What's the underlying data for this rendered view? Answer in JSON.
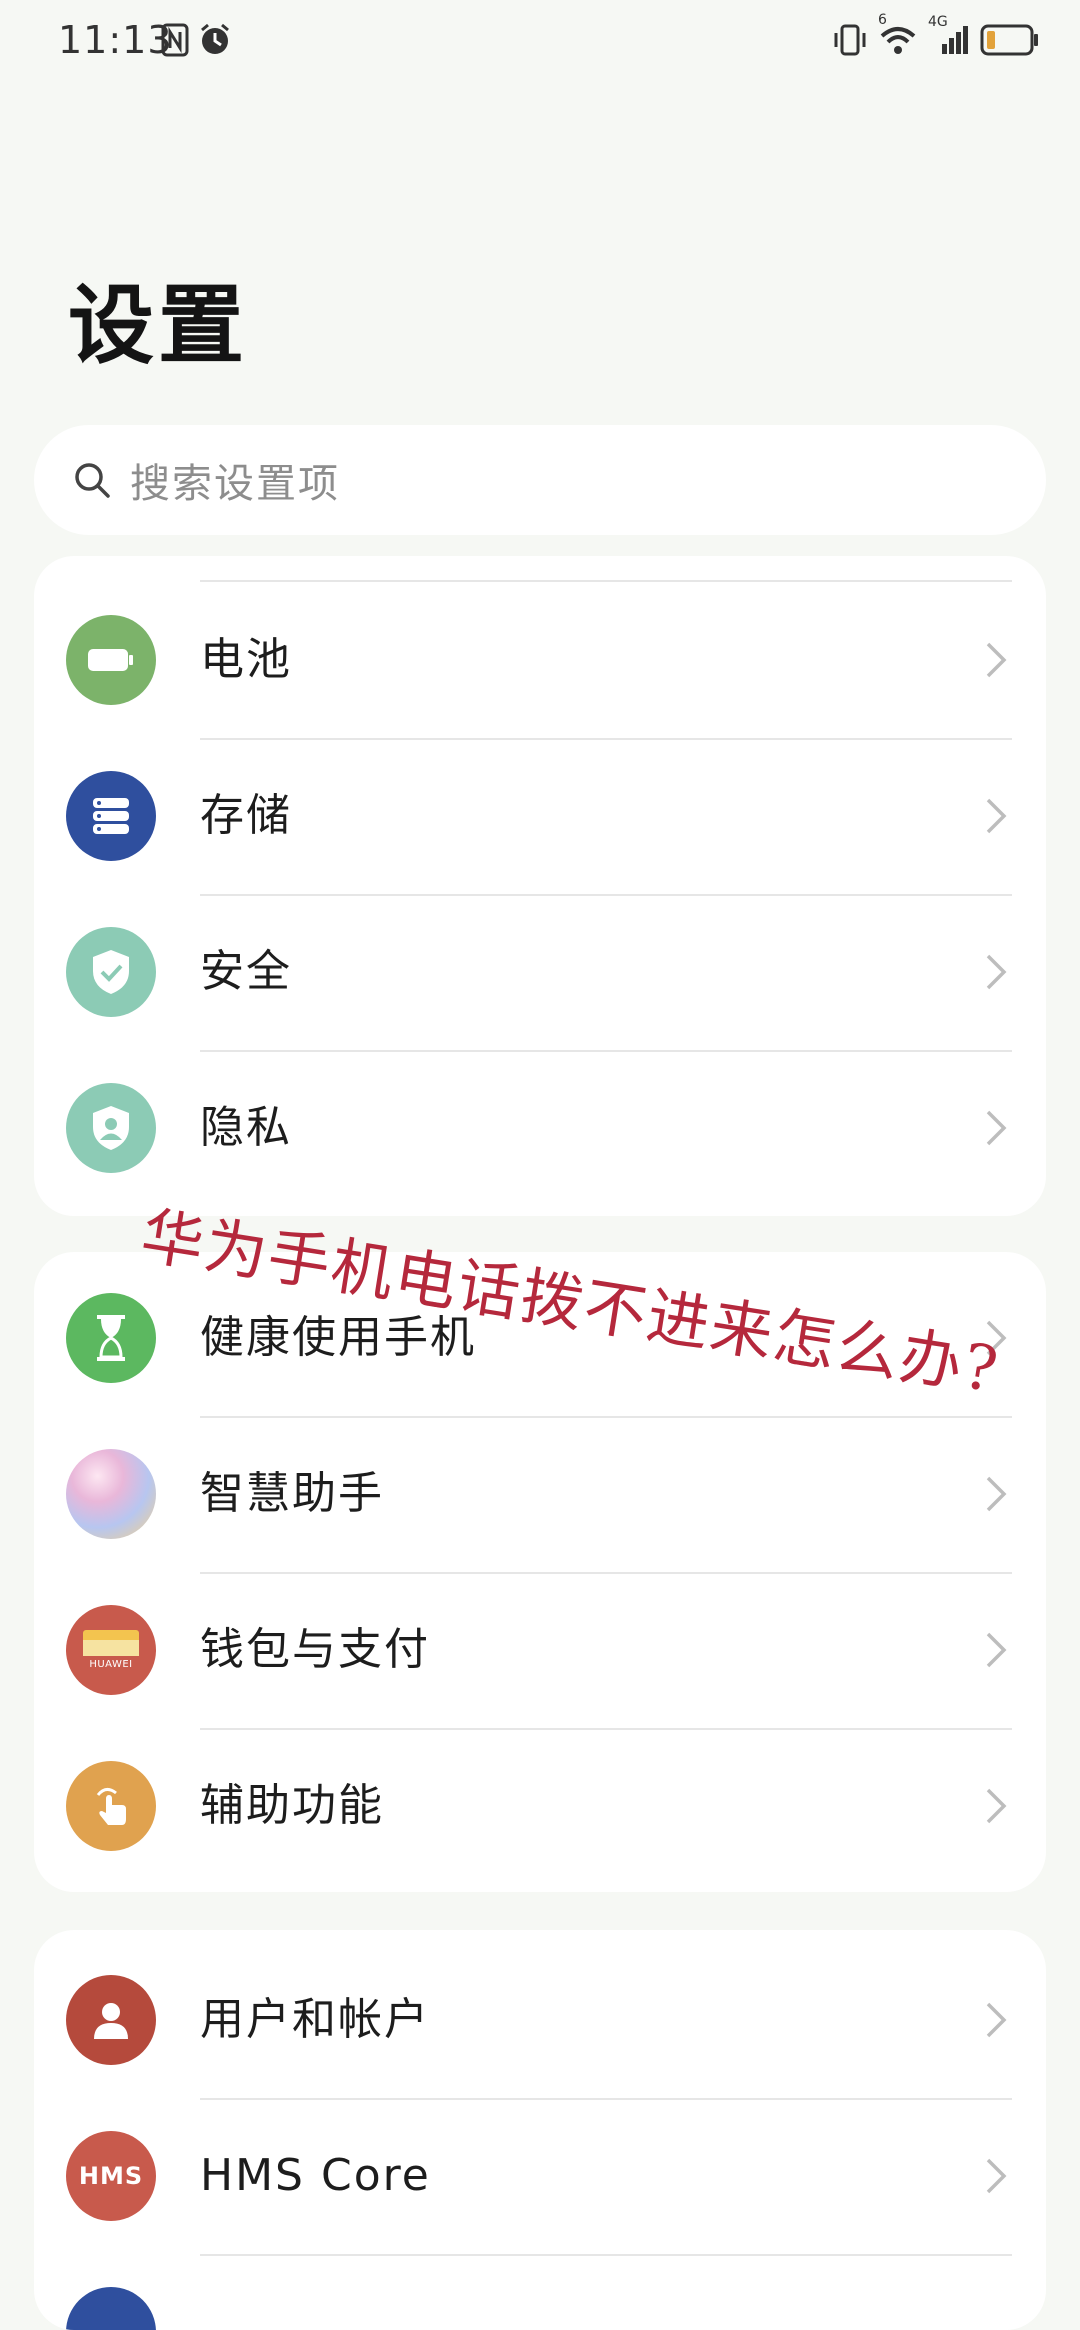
{
  "status_bar": {
    "time": "11:13",
    "left_icons": [
      "nfc-icon",
      "alarm-icon"
    ],
    "right_icons": [
      "vibrate-icon",
      "wifi-6-icon",
      "4g-signal-icon",
      "battery-low-icon"
    ],
    "network": "4G",
    "wifi_label": "6"
  },
  "page": {
    "title": "设置"
  },
  "search": {
    "placeholder": "搜索设置项"
  },
  "groups": [
    {
      "items": [
        {
          "label": "电池",
          "icon": "battery-icon",
          "color": "#7cb36a"
        },
        {
          "label": "存储",
          "icon": "storage-icon",
          "color": "#2f4f9e"
        },
        {
          "label": "安全",
          "icon": "shield-check-icon",
          "color": "#8ccbb5"
        },
        {
          "label": "隐私",
          "icon": "privacy-shield-icon",
          "color": "#8ccbb5"
        }
      ]
    },
    {
      "items": [
        {
          "label": "健康使用手机",
          "icon": "hourglass-icon",
          "color": "#5cb860"
        },
        {
          "label": "智慧助手",
          "icon": "assistant-orb-icon",
          "color": "#c9b6e8"
        },
        {
          "label": "钱包与支付",
          "icon": "wallet-icon",
          "color": "#c85a4c"
        },
        {
          "label": "辅助功能",
          "icon": "hand-touch-icon",
          "color": "#e0a24f"
        }
      ]
    },
    {
      "items": [
        {
          "label": "用户和帐户",
          "icon": "user-icon",
          "color": "#b54a3c"
        },
        {
          "label": "HMS Core",
          "icon": "hms-icon",
          "color": "#c85a4c"
        }
      ]
    }
  ],
  "wallet_icon_text": "HUAWEI",
  "hms_icon_text": "HMS",
  "overlay": {
    "caption": "华为手机电话拨不进来怎么办?"
  }
}
